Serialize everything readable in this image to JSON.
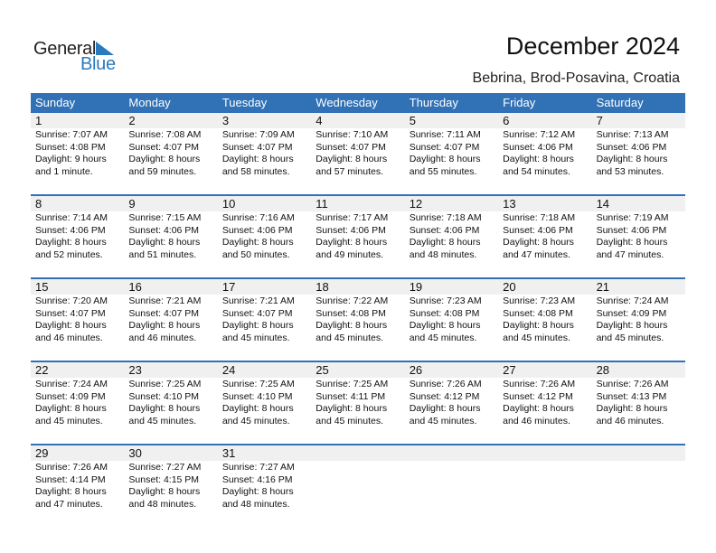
{
  "logo": {
    "word1": "General",
    "word2": "Blue",
    "brand_color": "#2a7abf"
  },
  "header": {
    "title": "December 2024",
    "location": "Bebrina, Brod-Posavina, Croatia"
  },
  "colors": {
    "header_bg": "#3171b5",
    "daynum_bg": "#f0f0f0"
  },
  "weekdays": [
    "Sunday",
    "Monday",
    "Tuesday",
    "Wednesday",
    "Thursday",
    "Friday",
    "Saturday"
  ],
  "weeks": [
    [
      {
        "day": "1",
        "sunrise": "Sunrise: 7:07 AM",
        "sunset": "Sunset: 4:08 PM",
        "daylight1": "Daylight: 9 hours",
        "daylight2": "and 1 minute."
      },
      {
        "day": "2",
        "sunrise": "Sunrise: 7:08 AM",
        "sunset": "Sunset: 4:07 PM",
        "daylight1": "Daylight: 8 hours",
        "daylight2": "and 59 minutes."
      },
      {
        "day": "3",
        "sunrise": "Sunrise: 7:09 AM",
        "sunset": "Sunset: 4:07 PM",
        "daylight1": "Daylight: 8 hours",
        "daylight2": "and 58 minutes."
      },
      {
        "day": "4",
        "sunrise": "Sunrise: 7:10 AM",
        "sunset": "Sunset: 4:07 PM",
        "daylight1": "Daylight: 8 hours",
        "daylight2": "and 57 minutes."
      },
      {
        "day": "5",
        "sunrise": "Sunrise: 7:11 AM",
        "sunset": "Sunset: 4:07 PM",
        "daylight1": "Daylight: 8 hours",
        "daylight2": "and 55 minutes."
      },
      {
        "day": "6",
        "sunrise": "Sunrise: 7:12 AM",
        "sunset": "Sunset: 4:06 PM",
        "daylight1": "Daylight: 8 hours",
        "daylight2": "and 54 minutes."
      },
      {
        "day": "7",
        "sunrise": "Sunrise: 7:13 AM",
        "sunset": "Sunset: 4:06 PM",
        "daylight1": "Daylight: 8 hours",
        "daylight2": "and 53 minutes."
      }
    ],
    [
      {
        "day": "8",
        "sunrise": "Sunrise: 7:14 AM",
        "sunset": "Sunset: 4:06 PM",
        "daylight1": "Daylight: 8 hours",
        "daylight2": "and 52 minutes."
      },
      {
        "day": "9",
        "sunrise": "Sunrise: 7:15 AM",
        "sunset": "Sunset: 4:06 PM",
        "daylight1": "Daylight: 8 hours",
        "daylight2": "and 51 minutes."
      },
      {
        "day": "10",
        "sunrise": "Sunrise: 7:16 AM",
        "sunset": "Sunset: 4:06 PM",
        "daylight1": "Daylight: 8 hours",
        "daylight2": "and 50 minutes."
      },
      {
        "day": "11",
        "sunrise": "Sunrise: 7:17 AM",
        "sunset": "Sunset: 4:06 PM",
        "daylight1": "Daylight: 8 hours",
        "daylight2": "and 49 minutes."
      },
      {
        "day": "12",
        "sunrise": "Sunrise: 7:18 AM",
        "sunset": "Sunset: 4:06 PM",
        "daylight1": "Daylight: 8 hours",
        "daylight2": "and 48 minutes."
      },
      {
        "day": "13",
        "sunrise": "Sunrise: 7:18 AM",
        "sunset": "Sunset: 4:06 PM",
        "daylight1": "Daylight: 8 hours",
        "daylight2": "and 47 minutes."
      },
      {
        "day": "14",
        "sunrise": "Sunrise: 7:19 AM",
        "sunset": "Sunset: 4:06 PM",
        "daylight1": "Daylight: 8 hours",
        "daylight2": "and 47 minutes."
      }
    ],
    [
      {
        "day": "15",
        "sunrise": "Sunrise: 7:20 AM",
        "sunset": "Sunset: 4:07 PM",
        "daylight1": "Daylight: 8 hours",
        "daylight2": "and 46 minutes."
      },
      {
        "day": "16",
        "sunrise": "Sunrise: 7:21 AM",
        "sunset": "Sunset: 4:07 PM",
        "daylight1": "Daylight: 8 hours",
        "daylight2": "and 46 minutes."
      },
      {
        "day": "17",
        "sunrise": "Sunrise: 7:21 AM",
        "sunset": "Sunset: 4:07 PM",
        "daylight1": "Daylight: 8 hours",
        "daylight2": "and 45 minutes."
      },
      {
        "day": "18",
        "sunrise": "Sunrise: 7:22 AM",
        "sunset": "Sunset: 4:08 PM",
        "daylight1": "Daylight: 8 hours",
        "daylight2": "and 45 minutes."
      },
      {
        "day": "19",
        "sunrise": "Sunrise: 7:23 AM",
        "sunset": "Sunset: 4:08 PM",
        "daylight1": "Daylight: 8 hours",
        "daylight2": "and 45 minutes."
      },
      {
        "day": "20",
        "sunrise": "Sunrise: 7:23 AM",
        "sunset": "Sunset: 4:08 PM",
        "daylight1": "Daylight: 8 hours",
        "daylight2": "and 45 minutes."
      },
      {
        "day": "21",
        "sunrise": "Sunrise: 7:24 AM",
        "sunset": "Sunset: 4:09 PM",
        "daylight1": "Daylight: 8 hours",
        "daylight2": "and 45 minutes."
      }
    ],
    [
      {
        "day": "22",
        "sunrise": "Sunrise: 7:24 AM",
        "sunset": "Sunset: 4:09 PM",
        "daylight1": "Daylight: 8 hours",
        "daylight2": "and 45 minutes."
      },
      {
        "day": "23",
        "sunrise": "Sunrise: 7:25 AM",
        "sunset": "Sunset: 4:10 PM",
        "daylight1": "Daylight: 8 hours",
        "daylight2": "and 45 minutes."
      },
      {
        "day": "24",
        "sunrise": "Sunrise: 7:25 AM",
        "sunset": "Sunset: 4:10 PM",
        "daylight1": "Daylight: 8 hours",
        "daylight2": "and 45 minutes."
      },
      {
        "day": "25",
        "sunrise": "Sunrise: 7:25 AM",
        "sunset": "Sunset: 4:11 PM",
        "daylight1": "Daylight: 8 hours",
        "daylight2": "and 45 minutes."
      },
      {
        "day": "26",
        "sunrise": "Sunrise: 7:26 AM",
        "sunset": "Sunset: 4:12 PM",
        "daylight1": "Daylight: 8 hours",
        "daylight2": "and 45 minutes."
      },
      {
        "day": "27",
        "sunrise": "Sunrise: 7:26 AM",
        "sunset": "Sunset: 4:12 PM",
        "daylight1": "Daylight: 8 hours",
        "daylight2": "and 46 minutes."
      },
      {
        "day": "28",
        "sunrise": "Sunrise: 7:26 AM",
        "sunset": "Sunset: 4:13 PM",
        "daylight1": "Daylight: 8 hours",
        "daylight2": "and 46 minutes."
      }
    ],
    [
      {
        "day": "29",
        "sunrise": "Sunrise: 7:26 AM",
        "sunset": "Sunset: 4:14 PM",
        "daylight1": "Daylight: 8 hours",
        "daylight2": "and 47 minutes."
      },
      {
        "day": "30",
        "sunrise": "Sunrise: 7:27 AM",
        "sunset": "Sunset: 4:15 PM",
        "daylight1": "Daylight: 8 hours",
        "daylight2": "and 48 minutes."
      },
      {
        "day": "31",
        "sunrise": "Sunrise: 7:27 AM",
        "sunset": "Sunset: 4:16 PM",
        "daylight1": "Daylight: 8 hours",
        "daylight2": "and 48 minutes."
      },
      null,
      null,
      null,
      null
    ]
  ]
}
